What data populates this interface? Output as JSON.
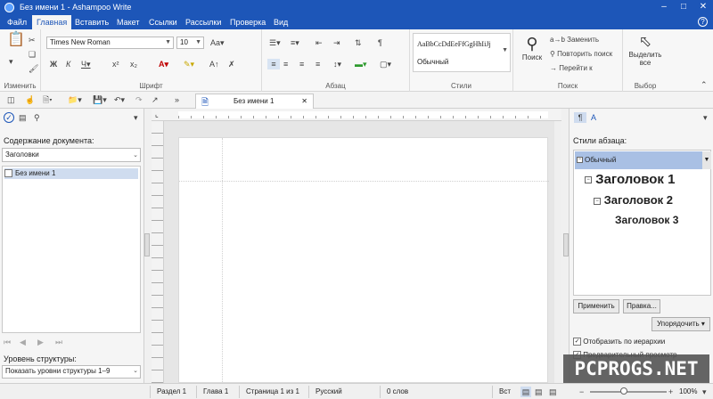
{
  "window": {
    "title": "Без имени 1 - Ashampoo Write"
  },
  "menu": {
    "tabs": [
      "Файл",
      "Главная",
      "Вставить",
      "Макет",
      "Ссылки",
      "Рассылки",
      "Проверка",
      "Вид"
    ]
  },
  "ribbon": {
    "groups": {
      "edit": "Изменить",
      "font": "Шрифт",
      "paragraph": "Абзац",
      "styles": "Стили",
      "search": "Поиск",
      "select": "Выбор"
    },
    "font_name": "Times New Roman",
    "font_size": "10",
    "style_preview": "AaBbCcDdEeFfGgHhIiJj",
    "style_name": "Обычный",
    "search_label": "Поиск",
    "replace_label": "Заменить",
    "repeat_search_label": "Повторить поиск",
    "goto_label": "Перейти к",
    "select_all_label": "Выделить все"
  },
  "document": {
    "tab_title": "Без имени 1"
  },
  "left_panel": {
    "contents_label": "Содержание документа:",
    "filter_value": "Заголовки",
    "tree_item": "Без имени 1",
    "level_label": "Уровень структуры:",
    "level_value": "Показать уровни структуры 1–9"
  },
  "right_panel": {
    "styles_label": "Стили абзаца:",
    "selected_style": "Обычный",
    "heading1": "Заголовок 1",
    "heading2": "Заголовок 2",
    "heading3": "Заголовок 3",
    "apply_button": "Применить",
    "edit_button": "Правка...",
    "sort_button": "Упорядочить",
    "hierarchy_label": "Отобразить по иерархии",
    "preview_label": "Предварительный просмотр"
  },
  "status": {
    "section": "Раздел 1",
    "chapter": "Глава 1",
    "page": "Страница 1 из 1",
    "language": "Русский",
    "words": "0 слов",
    "mode": "Вст",
    "zoom": "100%"
  },
  "watermark": "PCPROGS.NET"
}
